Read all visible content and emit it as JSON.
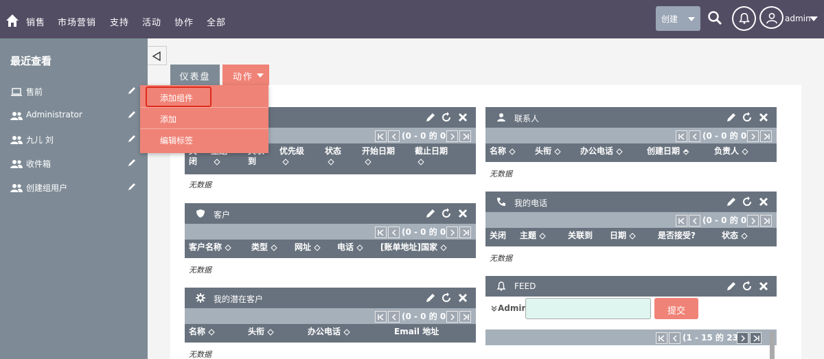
{
  "topnav": {
    "items": [
      "销售",
      "市场营销",
      "支持",
      "活动",
      "协作",
      "全部"
    ],
    "create_label": "创建",
    "user_name": "admin"
  },
  "sidebar": {
    "title": "最近查看",
    "items": [
      {
        "label": "售前",
        "icon": "laptop-icon"
      },
      {
        "label": "Administrator",
        "icon": "users-icon"
      },
      {
        "label": "九儿 刘",
        "icon": "users-icon"
      },
      {
        "label": "收件箱",
        "icon": "users-icon"
      },
      {
        "label": "创建组用户",
        "icon": "users-icon"
      }
    ]
  },
  "tabs": {
    "dashboard": "仪表盘",
    "actions": "动作"
  },
  "dropdown": {
    "items": [
      "添加组件",
      "添加",
      "编辑标签"
    ],
    "highlighted": "添加组件"
  },
  "pagination_text": "(0 - 0 的 0)",
  "no_data": "无数据",
  "dashlets": {
    "meetings": {
      "columns": [
        "关闭",
        "主题",
        "关联到",
        "优先级",
        "状态",
        "开始日期",
        "截止日期"
      ]
    },
    "accounts": {
      "title": "客户",
      "columns": [
        "客户名称",
        "类型",
        "网址",
        "电话",
        "[账单地址]国家"
      ]
    },
    "leads": {
      "title": "我的潜在客户",
      "columns": [
        "名称",
        "头衔",
        "办公电话",
        "Email 地址"
      ]
    },
    "contacts": {
      "title": "联系人",
      "columns": [
        "名称",
        "头衔",
        "办公电话",
        "创建日期",
        "负责人"
      ]
    },
    "calls": {
      "title": "我的电话",
      "columns": [
        "关闭",
        "主题",
        "关联到",
        "日期",
        "是否接受?",
        "状态"
      ]
    },
    "feed": {
      "title": "FEED",
      "user_label": "Admin",
      "submit_label": "提交",
      "pagination_text": "(1 - 15 的 23)"
    }
  },
  "colors": {
    "topbar": "#534d64",
    "sidebar": "#7e8b96",
    "accent": "#f08377",
    "dashlet_header": "#68727e",
    "highlight_border": "#e02a1a"
  }
}
